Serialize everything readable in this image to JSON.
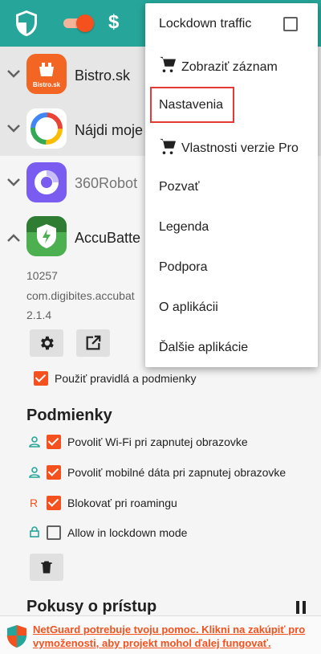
{
  "toolbar": {
    "shield_icon": "shield-icon",
    "lockdown_toggle_on": true,
    "pro_symbol": "$",
    "accent": "#26a69a",
    "toggle_color": "#f4511e"
  },
  "apps": [
    {
      "name": "Bistro.sk",
      "logo_text": "Bistro.sk",
      "icon": "bistro-icon",
      "expanded": false
    },
    {
      "name": "Nájdi moje",
      "icon": "find-my-device-icon",
      "expanded": false
    },
    {
      "name": "360Robot",
      "icon": "360robot-icon",
      "expanded": false
    },
    {
      "name": "AccuBatte",
      "icon": "accubattery-icon",
      "expanded": true
    }
  ],
  "app_detail": {
    "uid": "10257",
    "package": "com.digibites.accubat",
    "version": "2.1.4",
    "apply_rules_label": "Použiť pravidlá a podmienky",
    "apply_rules_checked": true
  },
  "conditions": {
    "title": "Podmienky",
    "items": [
      {
        "label": "Povoliť Wi-Fi pri zapnutej obrazovke",
        "checked": true,
        "icon": "person-icon"
      },
      {
        "label": "Povoliť mobilné dáta pri zapnutej obrazovke",
        "checked": true,
        "icon": "person-icon"
      },
      {
        "label": "Blokovať pri roamingu",
        "checked": true,
        "icon": "roaming-icon",
        "icon_text": "R"
      },
      {
        "label": "Allow in lockdown mode",
        "checked": false,
        "icon": "lock-icon"
      }
    ]
  },
  "access": {
    "title": "Pokusy o prístup"
  },
  "menu": {
    "items": [
      {
        "label": "Lockdown traffic",
        "checkbox": true,
        "checked": false
      },
      {
        "label": "Zobraziť záznam",
        "cart": true
      },
      {
        "label": "Nastavenia",
        "highlighted": true
      },
      {
        "label": "Vlastnosti verzie Pro",
        "cart": true
      },
      {
        "label": "Pozvať"
      },
      {
        "label": "Legenda"
      },
      {
        "label": "Podpora"
      },
      {
        "label": "O aplikácii"
      },
      {
        "label": "Ďalšie aplikácie"
      }
    ]
  },
  "banner": {
    "text": "NetGuard potrebuje tvoju pomoc. Klikni na zakúpiť pro vymoženosti, aby projekt mohol ďalej fungovať."
  }
}
